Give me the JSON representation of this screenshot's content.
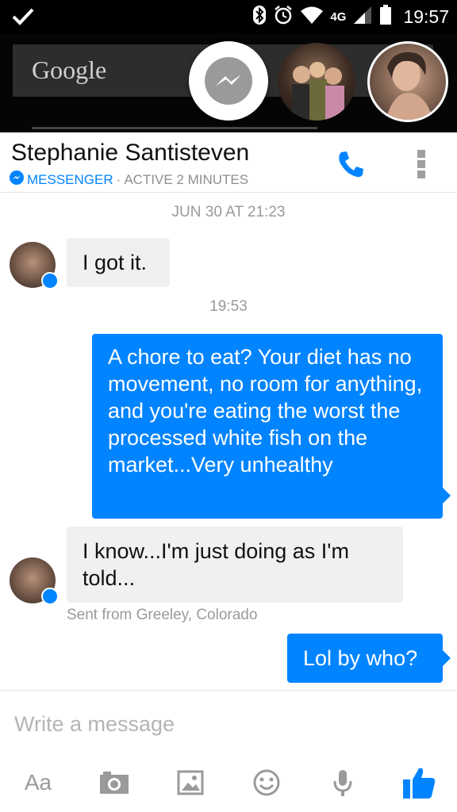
{
  "status_bar": {
    "time": "19:57",
    "network": "4G",
    "icons": [
      "check-icon",
      "bluetooth-icon",
      "alarm-icon",
      "wifi-icon",
      "signal-icon",
      "battery-icon"
    ]
  },
  "homescreen": {
    "search_logo": "Google"
  },
  "chat_heads": [
    {
      "name": "messenger-chathead",
      "icon": "messenger-icon"
    },
    {
      "name": "group-chathead"
    },
    {
      "name": "contact-chathead"
    }
  ],
  "header": {
    "contact_name": "Stephanie Santisteven",
    "app_label": "MESSENGER",
    "separator": "·",
    "status": "ACTIVE 2 MINUTES"
  },
  "conversation": {
    "date_stamp": "JUN 30 AT 21:23",
    "time_stamp": "19:53",
    "messages": [
      {
        "from": "them",
        "text": "I got it."
      },
      {
        "from": "me",
        "text": "A chore to eat? Your diet has no movement, no room for anything, and you're eating the worst the processed white fish on the market...Very unhealthy"
      },
      {
        "from": "them",
        "text": "I know...I'm just doing as I'm told..."
      },
      {
        "from": "me",
        "text": "Lol by who?"
      }
    ],
    "location_note": "Sent from Greeley, Colorado"
  },
  "composer": {
    "placeholder": "Write a message",
    "text_tool_label": "Aa",
    "tools": [
      "text-icon",
      "camera-icon",
      "gallery-icon",
      "emoji-icon",
      "microphone-icon",
      "like-icon"
    ]
  },
  "colors": {
    "accent": "#0084ff",
    "incoming_bubble": "#f1f0f0",
    "muted_text": "#9a9a9a"
  }
}
